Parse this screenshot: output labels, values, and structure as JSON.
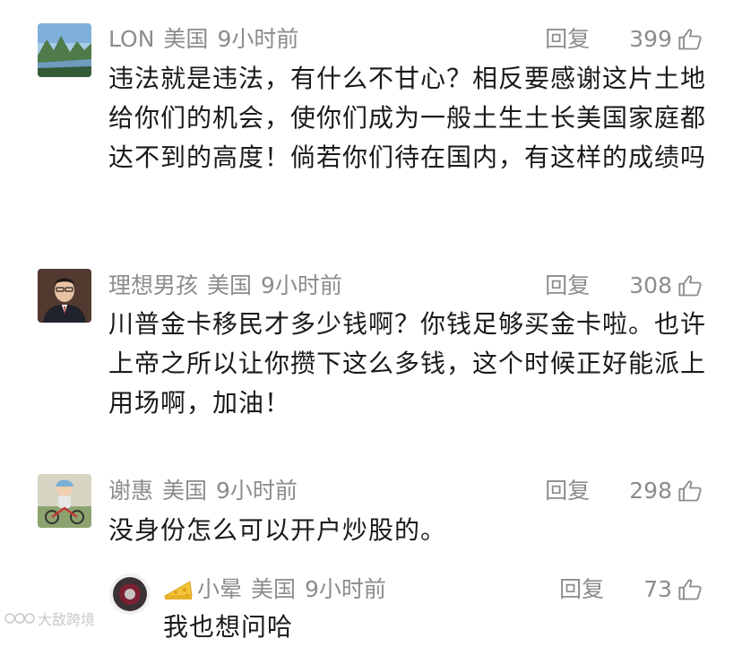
{
  "comments": [
    {
      "user": "LON",
      "location": "美国",
      "time": "9小时前",
      "reply_label": "回复",
      "likes": "399",
      "text": "违法就是违法，有什么不甘心？相反要感谢这片土地给你们的机会，使你们成为一般土生土长美国家庭都达不到的高度！倘若你们待在国内，有这样的成绩吗"
    },
    {
      "user": "理想男孩",
      "location": "美国",
      "time": "9小时前",
      "reply_label": "回复",
      "likes": "308",
      "text": "川普金卡移民才多少钱啊？你钱足够买金卡啦。也许上帝之所以让你攒下这么多钱，这个时候正好能派上用场啊，加油！"
    },
    {
      "user": "谢惠",
      "location": "美国",
      "time": "9小时前",
      "reply_label": "回复",
      "likes": "298",
      "text": "没身份怎么可以开户炒股的。"
    }
  ],
  "reply": {
    "user": "小晕",
    "location": "美国",
    "time": "9小时前",
    "reply_label": "回复",
    "likes": "73",
    "text": "我也想问哈",
    "badge_icon": "cheese-icon"
  },
  "watermark": {
    "text": "大敌跨境"
  },
  "colors": {
    "meta": "#8c8c8c",
    "text": "#1a1a1a"
  }
}
